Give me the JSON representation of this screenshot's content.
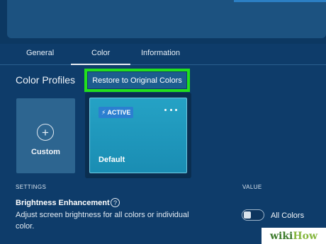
{
  "tabs": [
    {
      "label": "General"
    },
    {
      "label": "Color"
    },
    {
      "label": "Information"
    }
  ],
  "color_profiles": {
    "title": "Color Profiles",
    "restore_button": "Restore to Original Colors",
    "highlight_color": "#22e01c",
    "cards": {
      "custom": {
        "icon": "plus-icon",
        "label": "Custom"
      },
      "default": {
        "badge": "ACTIVE",
        "badge_icon": "lightning-bolt-icon",
        "menu_icon": "more-dots-icon",
        "label": "Default"
      }
    }
  },
  "settings_table": {
    "headers": {
      "settings": "SETTINGS",
      "value": "VALUE"
    },
    "rows": [
      {
        "name": "Brightness Enhancement",
        "help_icon": "?",
        "description": "Adjust screen brightness for all colors or individual color.",
        "toggle_on": false,
        "toggle_label": "All Colors"
      }
    ]
  },
  "watermark": {
    "wiki": "wiki",
    "how": "How"
  }
}
